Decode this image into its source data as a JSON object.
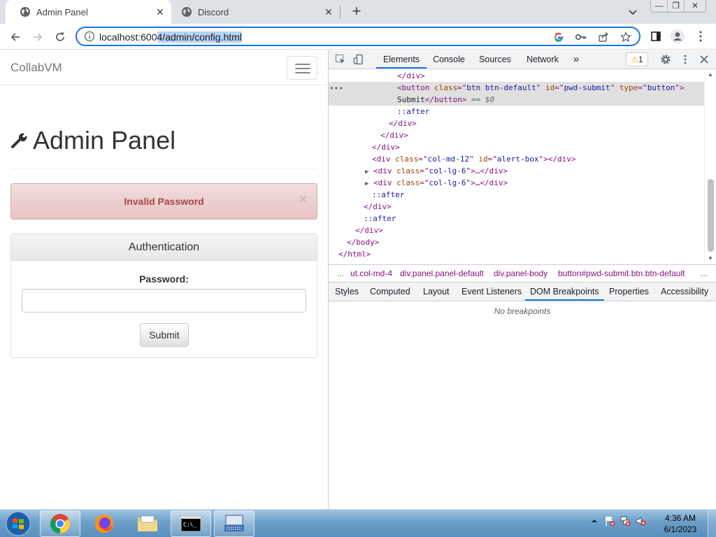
{
  "browser": {
    "tabs": [
      {
        "title": "Admin Panel",
        "active": true,
        "icon": "globe-icon"
      },
      {
        "title": "Discord",
        "active": false,
        "icon": "globe-icon"
      }
    ],
    "window_controls": {
      "minimize": "—",
      "restore": "❐",
      "close": "✕"
    },
    "address": {
      "host": "localhost:6004",
      "path": "/admin/config.html",
      "selected_text": "4/admin/config.html",
      "prefix_text": "localhost:600"
    },
    "omnibox_icons": [
      "google-icon",
      "key-icon",
      "share-icon",
      "star-icon"
    ]
  },
  "page": {
    "brand": "CollabVM",
    "heading": "Admin Panel",
    "alert": {
      "text": "Invalid Password",
      "close": "×"
    },
    "panel": {
      "title": "Authentication",
      "password_label": "Password:",
      "password_value": "",
      "submit_label": "Submit"
    }
  },
  "devtools": {
    "tabs": [
      "Elements",
      "Console",
      "Sources",
      "Network",
      "»"
    ],
    "active_tab": "Elements",
    "warnings": "1",
    "dom_lines": [
      {
        "indent": 8,
        "text": "</div>"
      },
      {
        "indent": 8,
        "text": "<button class=\"btn btn-default\" id=\"pwd-submit\" type=\"button\">"
      },
      {
        "indent": 8,
        "text": "Submit</button> == $0"
      },
      {
        "indent": 8,
        "text": "::after"
      },
      {
        "indent": 7,
        "text": "</div>"
      },
      {
        "indent": 6,
        "text": "</div>"
      },
      {
        "indent": 5,
        "text": "</div>"
      },
      {
        "indent": 5,
        "text": "<div class=\"col-md-12\" id=\"alert-box\"></div>"
      },
      {
        "indent": 5,
        "text": "<div class=\"col-lg-6\">…</div>"
      },
      {
        "indent": 5,
        "text": "<div class=\"col-lg-6\">…</div>"
      },
      {
        "indent": 5,
        "text": "::after"
      },
      {
        "indent": 4,
        "text": "</div>"
      },
      {
        "indent": 4,
        "text": "::after"
      },
      {
        "indent": 3,
        "text": "</div>"
      },
      {
        "indent": 2,
        "text": "</body>"
      },
      {
        "indent": 1,
        "text": "</html>"
      }
    ],
    "breadcrumbs": [
      "...",
      "ut.col-md-4",
      "div.panel.panel-default",
      "div.panel-body",
      "button#pwd-submit.btn.btn-default",
      "..."
    ],
    "sidebar_tabs": [
      "Styles",
      "Computed",
      "Layout",
      "Event Listeners",
      "DOM Breakpoints",
      "Properties",
      "Accessibility"
    ],
    "active_sidebar_tab": "DOM Breakpoints",
    "no_breakpoints": "No breakpoints"
  },
  "taskbar": {
    "apps": [
      "chrome-icon",
      "firefox-icon",
      "explorer-folder-icon",
      "cmd-icon",
      "keyboard-icon"
    ],
    "clock_time": "4:36 AM",
    "clock_date": "6/1/2023"
  },
  "colors": {
    "accent": "#1a73e8",
    "alert_text": "#a94442",
    "alert_bg": "#f2dede",
    "selection": "#b4d3f7"
  }
}
